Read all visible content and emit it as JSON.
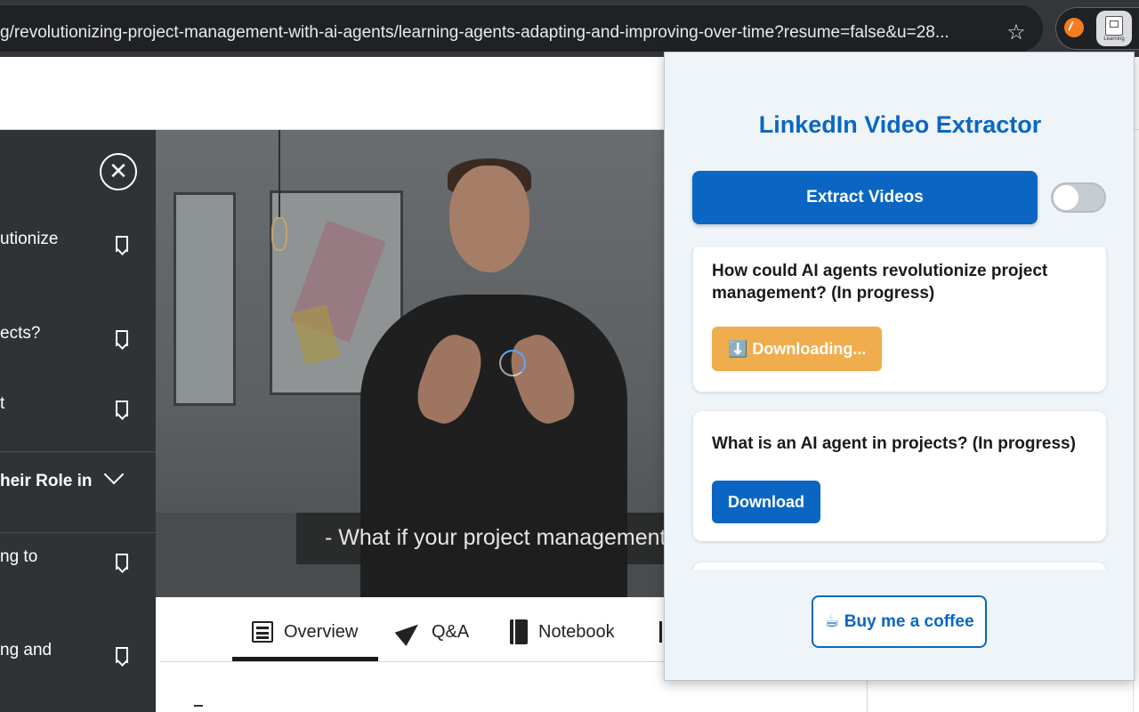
{
  "browser": {
    "url": "g/revolutionizing-project-management-with-ai-agents/learning-agents-adapting-and-improving-over-time?resume=false&u=28...",
    "star_glyph": "☆",
    "extensions": [
      "orange-extension-icon",
      "linkedin-learning-extension-icon"
    ],
    "ext_caption": "Learning"
  },
  "sidebar": {
    "close_glyph": "✕",
    "items": [
      {
        "label": "utionize",
        "icon": "bookmark-icon"
      },
      {
        "label": "ects?",
        "icon": "bookmark-icon"
      },
      {
        "label": "t",
        "icon": "bookmark-icon"
      },
      {
        "label": "heir Role in",
        "icon": "chevron-down-icon"
      },
      {
        "label": "ng to",
        "icon": "bookmark-icon"
      },
      {
        "label": "ng and",
        "icon": "bookmark-icon"
      }
    ]
  },
  "video": {
    "caption": "- What if your project management to"
  },
  "tabs": [
    {
      "label": "Overview",
      "icon": "overview-icon",
      "active": true
    },
    {
      "label": "Q&A",
      "icon": "paper-plane-icon",
      "active": false
    },
    {
      "label": "Notebook",
      "icon": "notebook-icon",
      "active": false
    }
  ],
  "popup": {
    "title": "LinkedIn Video Extractor",
    "extract_label": "Extract Videos",
    "toggle_on": false,
    "videos": [
      {
        "title": "How could AI agents revolutionize project management? (In progress)",
        "button_label": "⬇️ Downloading...",
        "state": "downloading"
      },
      {
        "title": "What is an AI agent in projects? (In progress)",
        "button_label": "Download",
        "state": "ready"
      }
    ],
    "coffee_label": "☕ Buy me a coffee"
  },
  "colors": {
    "brand": "#0a66c2",
    "downloading": "#f0ad4e",
    "sidebar": "#2f3336",
    "browser_chrome": "#35363a"
  }
}
